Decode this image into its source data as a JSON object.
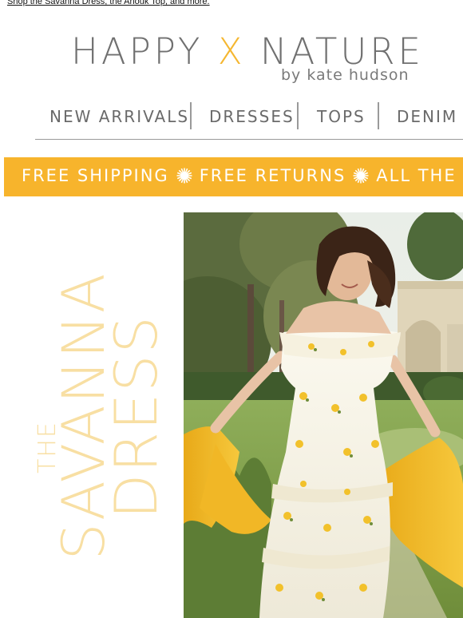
{
  "preheader": {
    "text": "Shop the Savanna Dress, the Anouk Top, and more."
  },
  "brand": {
    "name_left": "HAPPY",
    "name_x": "X",
    "name_right": "NATURE",
    "byline": "by kate hudson",
    "accent_color": "#f5b731",
    "text_color": "#707070"
  },
  "nav": {
    "items": [
      {
        "label": "NEW ARRIVALS"
      },
      {
        "label": "DRESSES"
      },
      {
        "label": "TOPS"
      },
      {
        "label": "DENIM"
      }
    ]
  },
  "banner": {
    "background": "#f7b42c",
    "items": [
      "FREE SHIPPING",
      "FREE RETURNS",
      "ALL THE TIME"
    ],
    "separator_icon": "sun-icon"
  },
  "hero": {
    "title_line1": "THE",
    "title_line2": "SAVANNA",
    "title_line3": "DRESS",
    "title_color": "#f8dfa3",
    "image_description_icon": "model-photo"
  }
}
